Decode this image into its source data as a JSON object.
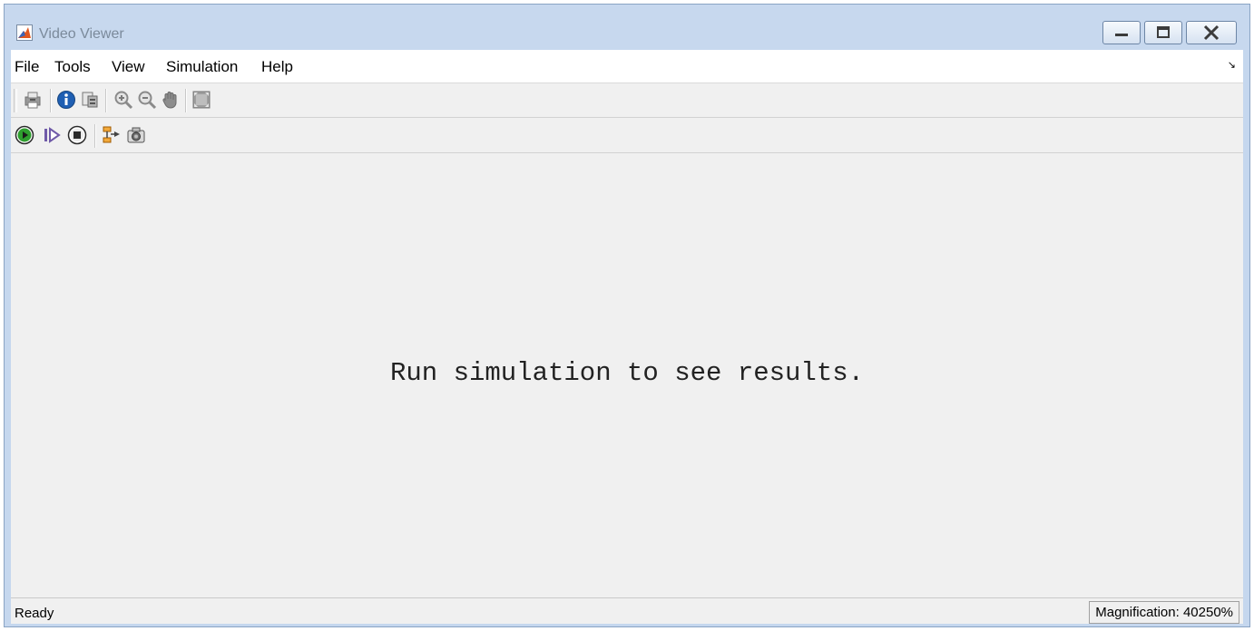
{
  "window": {
    "title": "Video Viewer"
  },
  "menu": {
    "items": [
      "File",
      "Tools",
      "View",
      "Simulation",
      "Help"
    ]
  },
  "toolbar1": {
    "icons": [
      "print-icon",
      "info-icon",
      "export-icon",
      "zoom-in-icon",
      "zoom-out-icon",
      "pan-hand-icon",
      "fit-to-view-icon"
    ]
  },
  "toolbar2": {
    "icons": [
      "run-icon",
      "step-forward-icon",
      "stop-icon",
      "highlight-block-icon",
      "snapshot-icon"
    ]
  },
  "display": {
    "message": "Run simulation to see results."
  },
  "status": {
    "text": "Ready",
    "magnification": "Magnification: 40250%"
  },
  "colors": {
    "titlebar": "#c7d8ee",
    "run_green": "#2e9e2e",
    "info_blue": "#1f5fb3",
    "background": "#f0f0f0"
  }
}
